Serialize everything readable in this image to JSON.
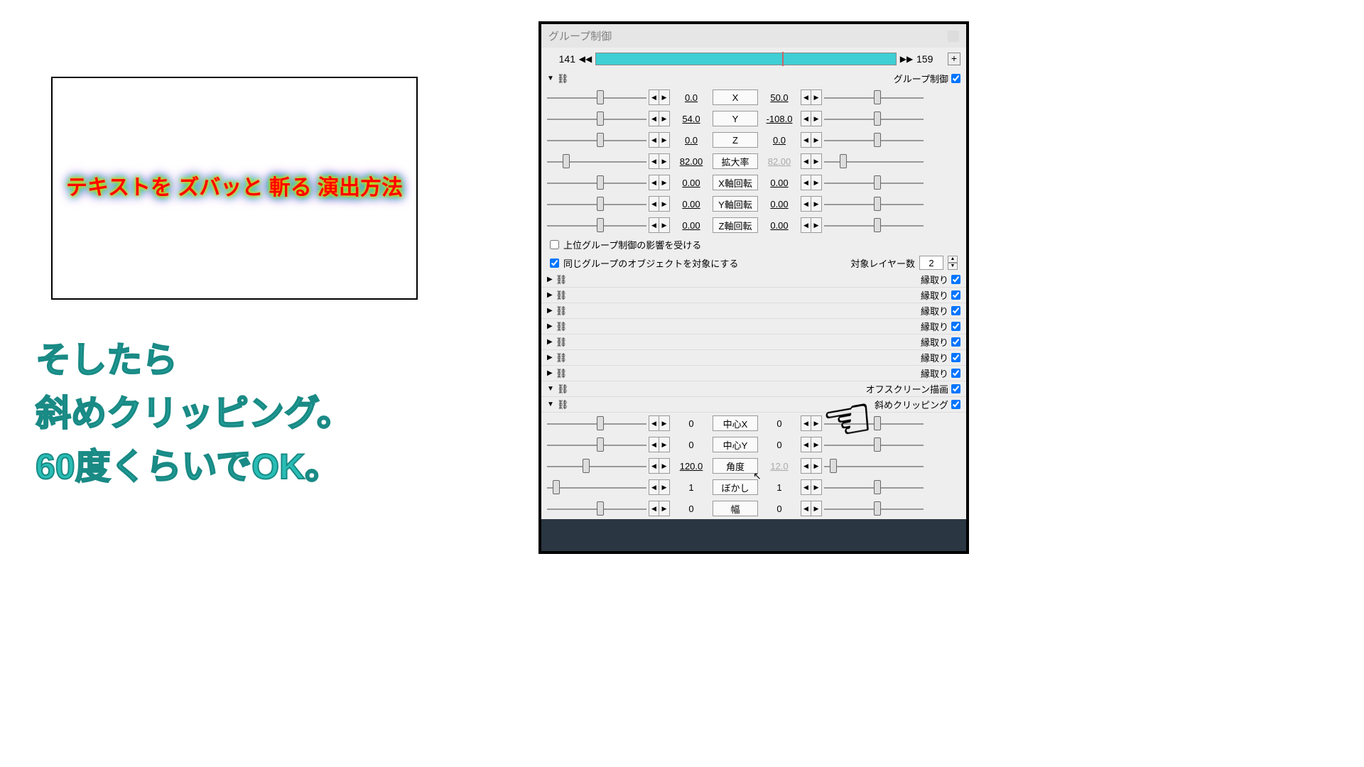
{
  "preview": {
    "text": "テキストを ズバッと\n斬る 演出方法"
  },
  "caption": {
    "l1": "そしたら",
    "l2": "斜めクリッピング。",
    "l3": "60度くらいでOK。"
  },
  "panel": {
    "title": "グループ制御",
    "timeline": {
      "start": "141",
      "end": "159"
    },
    "group_label": "グループ制御",
    "params": [
      {
        "name": "X",
        "vl": "0.0",
        "vr": "50.0",
        "tl": 50,
        "tr": 50
      },
      {
        "name": "Y",
        "vl": "54.0",
        "vr": "-108.0",
        "tl": 50,
        "tr": 50
      },
      {
        "name": "Z",
        "vl": "0.0",
        "vr": "0.0",
        "tl": 50,
        "tr": 50
      },
      {
        "name": "拡大率",
        "vl": "82.00",
        "vr": "82.00",
        "tl": 16,
        "tr": 16,
        "rd": true
      },
      {
        "name": "X軸回転",
        "vl": "0.00",
        "vr": "0.00",
        "tl": 50,
        "tr": 50
      },
      {
        "name": "Y軸回転",
        "vl": "0.00",
        "vr": "0.00",
        "tl": 50,
        "tr": 50
      },
      {
        "name": "Z軸回転",
        "vl": "0.00",
        "vr": "0.00",
        "tl": 50,
        "tr": 50
      }
    ],
    "opt1": "上位グループ制御の影響を受ける",
    "opt2": "同じグループのオブジェクトを対象にする",
    "layer_label": "対象レイヤー数",
    "layer_val": "2",
    "filters": [
      {
        "label": "縁取り",
        "open": false
      },
      {
        "label": "縁取り",
        "open": false
      },
      {
        "label": "縁取り",
        "open": false
      },
      {
        "label": "縁取り",
        "open": false
      },
      {
        "label": "縁取り",
        "open": false
      },
      {
        "label": "縁取り",
        "open": false
      },
      {
        "label": "縁取り",
        "open": false
      },
      {
        "label": "オフスクリーン描画",
        "open": true
      },
      {
        "label": "斜めクリッピング",
        "open": true
      }
    ],
    "clip_params": [
      {
        "name": "中心X",
        "vl": "0",
        "vr": "0",
        "tl": 50,
        "tr": 50,
        "plain": true
      },
      {
        "name": "中心Y",
        "vl": "0",
        "vr": "0",
        "tl": 50,
        "tr": 50,
        "plain": true
      },
      {
        "name": "角度",
        "vl": "120.0",
        "vr": "12.0",
        "tl": 36,
        "tr": 6,
        "plain": false,
        "rd": true
      },
      {
        "name": "ぼかし",
        "vl": "1",
        "vr": "1",
        "tl": 6,
        "tr": 50,
        "plain": true
      },
      {
        "name": "幅",
        "vl": "0",
        "vr": "0",
        "tl": 50,
        "tr": 50,
        "plain": true
      }
    ]
  }
}
